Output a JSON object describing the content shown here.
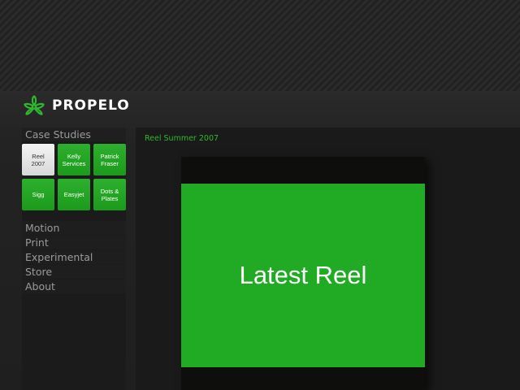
{
  "brand": {
    "name": "PROPELO",
    "logo_icon": "propeller-icon",
    "accent_color": "#21aa24"
  },
  "sidebar": {
    "header": "Case Studies",
    "tiles": [
      {
        "label_line1": "Reel",
        "label_line2": "2007",
        "active": true
      },
      {
        "label_line1": "Kelly",
        "label_line2": "Services",
        "active": false
      },
      {
        "label_line1": "Patrick",
        "label_line2": "Fraser",
        "active": false
      },
      {
        "label_line1": "Sigg",
        "label_line2": "",
        "active": false
      },
      {
        "label_line1": "Easyjet",
        "label_line2": "",
        "active": false
      },
      {
        "label_line1": "Dots &",
        "label_line2": "Plates",
        "active": false
      }
    ],
    "menu": [
      {
        "label": "Motion"
      },
      {
        "label": "Print"
      },
      {
        "label": "Experimental"
      },
      {
        "label": "Store"
      },
      {
        "label": "About"
      }
    ]
  },
  "content": {
    "breadcrumb": "Reel Summer 2007",
    "video_title": "Latest Reel"
  }
}
